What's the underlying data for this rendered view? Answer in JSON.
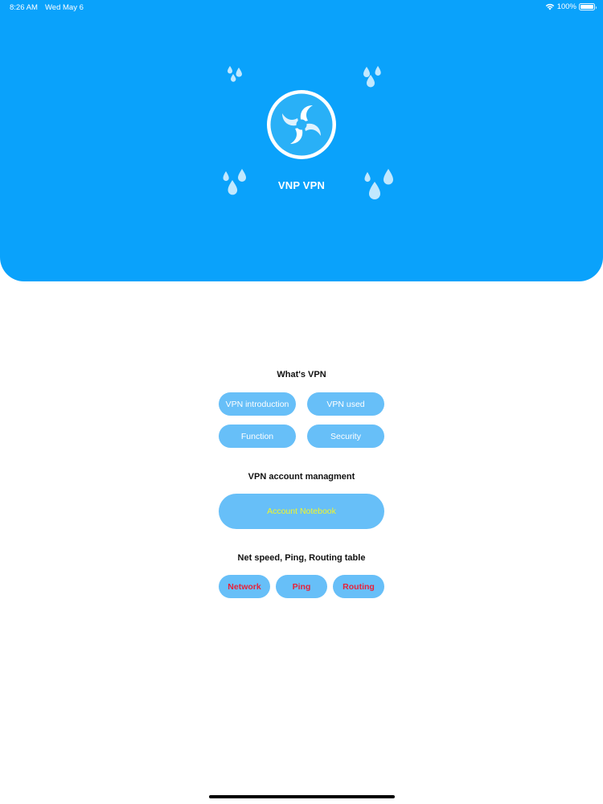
{
  "status_bar": {
    "time": "8:26 AM",
    "date": "Wed May 6",
    "battery_text": "100%"
  },
  "header": {
    "app_title": "VNP VPN",
    "background_color": "#0aa2fb"
  },
  "sections": {
    "whats_vpn": {
      "title": "What's VPN",
      "buttons": [
        "VPN introduction",
        "VPN used",
        "Function",
        "Security"
      ]
    },
    "account": {
      "title": "VPN account managment",
      "button": "Account Notebook"
    },
    "tools": {
      "title": "Net speed, Ping, Routing table",
      "buttons": [
        "Network",
        "Ping",
        "Routing"
      ]
    }
  },
  "colors": {
    "pill_background": "#67bff8",
    "account_text": "#f1f527",
    "tools_text": "#e8213a"
  },
  "icons": [
    "wifi-icon",
    "battery-icon",
    "app-logo-icon",
    "water-drops-icon"
  ]
}
